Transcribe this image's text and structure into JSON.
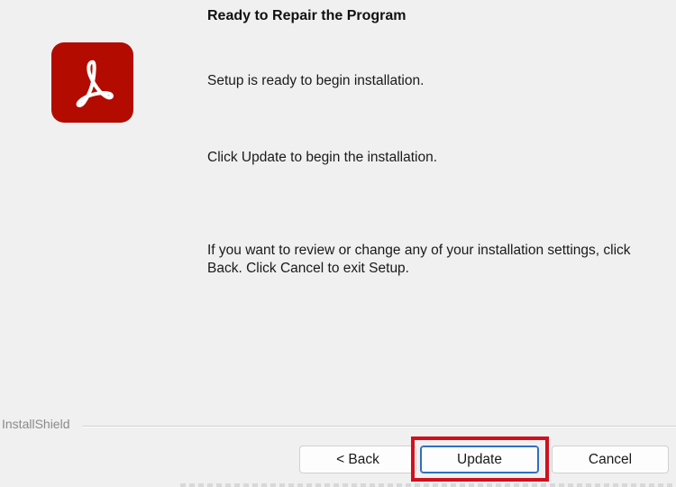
{
  "dialog": {
    "title": "Ready to Repair the Program",
    "message_ready": "Setup is ready to begin installation.",
    "message_click": "Click Update to begin the installation.",
    "message_review": "If you want to review or change any of your installation settings, click Back. Click Cancel to exit Setup.",
    "brand": "InstallShield"
  },
  "buttons": {
    "back": "< Back",
    "update": "Update",
    "cancel": "Cancel"
  },
  "icons": {
    "logo": "adobe-acrobat-logo-icon"
  },
  "colors": {
    "logo_bg": "#b30b00",
    "highlight": "#d0101e",
    "focus": "#2f6fbf"
  }
}
